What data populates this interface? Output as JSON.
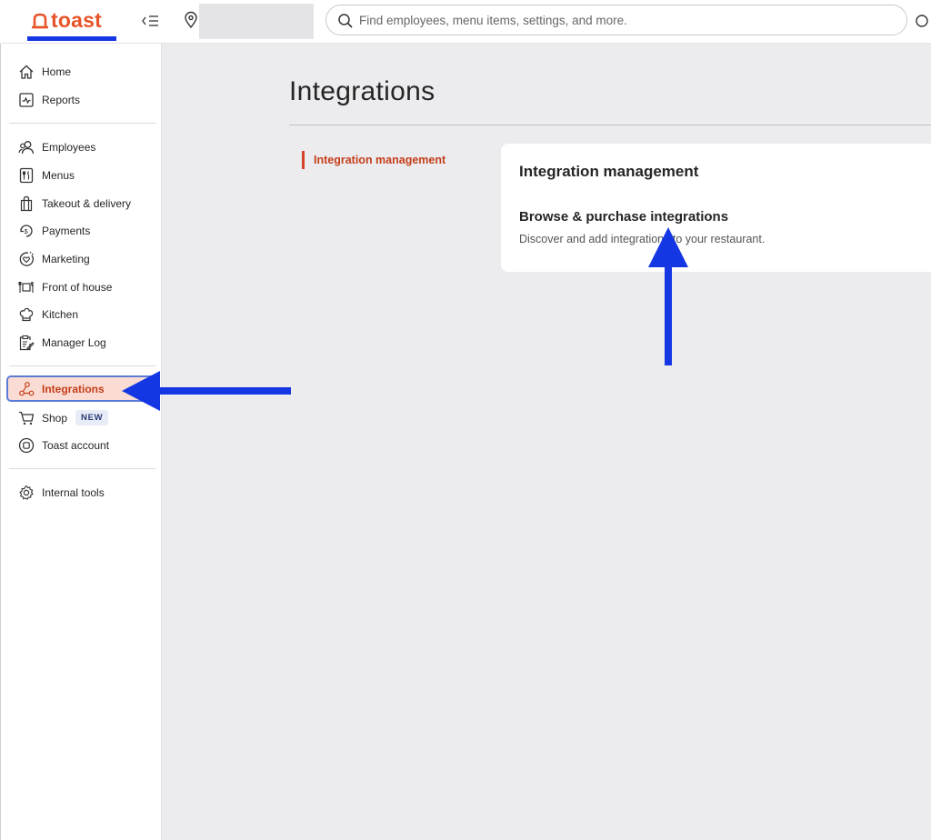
{
  "header": {
    "logo_text": "toast",
    "location_name": "",
    "search_placeholder": "Find employees, menu items, settings, and more."
  },
  "sidebar": {
    "items": [
      {
        "label": "Home",
        "icon": "home-icon"
      },
      {
        "label": "Reports",
        "icon": "reports-icon"
      },
      {
        "label": "Employees",
        "icon": "employees-icon"
      },
      {
        "label": "Menus",
        "icon": "menus-icon"
      },
      {
        "label": "Takeout & delivery",
        "icon": "takeout-bag-icon"
      },
      {
        "label": "Payments",
        "icon": "payments-icon"
      },
      {
        "label": "Marketing",
        "icon": "marketing-icon"
      },
      {
        "label": "Front of house",
        "icon": "front-of-house-icon"
      },
      {
        "label": "Kitchen",
        "icon": "chef-hat-icon"
      },
      {
        "label": "Manager Log",
        "icon": "manager-log-icon"
      },
      {
        "label": "Integrations",
        "icon": "integrations-icon",
        "active": true
      },
      {
        "label": "Shop",
        "icon": "cart-icon",
        "badge": "NEW"
      },
      {
        "label": "Toast account",
        "icon": "toast-account-icon"
      },
      {
        "label": "Internal tools",
        "icon": "gear-icon"
      }
    ]
  },
  "main": {
    "title": "Integrations",
    "subnav": [
      "Integration management"
    ],
    "card": {
      "title": "Integration management",
      "link_title": "Browse & purchase integrations",
      "link_description": "Discover and add integrations to your restaurant."
    }
  },
  "colors": {
    "brand": "#e8542a",
    "active_text": "#c43e1a",
    "active_bg": "#fadcd4",
    "annotation_blue": "#1437e3",
    "page_bg": "#ececef"
  }
}
